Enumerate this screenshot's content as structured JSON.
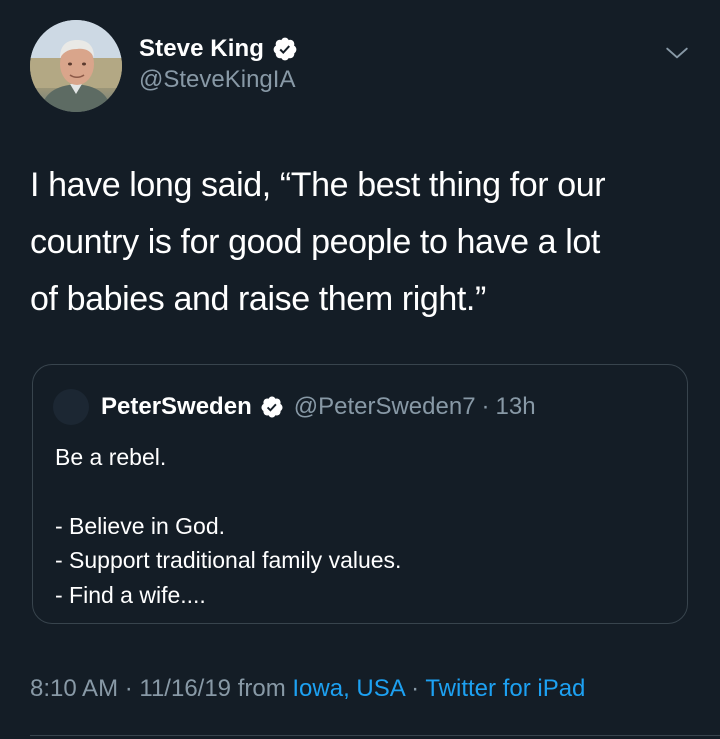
{
  "tweet": {
    "author": {
      "display_name": "Steve King",
      "handle": "@SteveKingIA",
      "verified": true
    },
    "text_lines": [
      "I have long said, “The best thing for our",
      "country is for good people to have a lot",
      "of babies and raise them right.”"
    ],
    "quoted": {
      "display_name": "PeterSweden",
      "handle": "@PeterSweden7",
      "separator": "·",
      "time": "13h",
      "lines": [
        "Be a rebel.",
        "",
        "- Believe in God.",
        "- Support traditional family values.",
        "- Find a wife...."
      ]
    },
    "meta": {
      "time": "8:10 AM",
      "sep1": " · ",
      "date": "11/16/19",
      "from": " from ",
      "location": "Iowa, USA",
      "sep2": " · ",
      "source": "Twitter for iPad"
    }
  },
  "icons": {
    "verified": "verified-badge-icon",
    "menu": "chevron-down-icon"
  },
  "colors": {
    "background": "#141d26",
    "text": "#ffffff",
    "secondary": "#8899a6",
    "link": "#1da1f2",
    "border": "#38444d"
  }
}
